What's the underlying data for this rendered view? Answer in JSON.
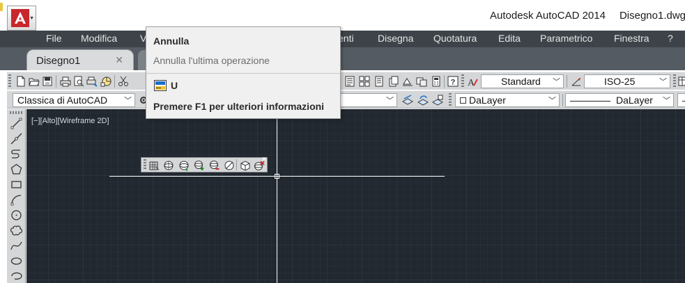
{
  "titlebar": {
    "app_name": "Autodesk AutoCAD 2014",
    "file_name": "Disegno1.dwg"
  },
  "menu": {
    "items": [
      "File",
      "Modifica",
      "V",
      "enti",
      "Disegna",
      "Quotatura",
      "Edita",
      "Parametrico",
      "Finestra",
      "?"
    ]
  },
  "tabs": {
    "active_label": "Disegno1",
    "close_glyph": "✕"
  },
  "toolbar1": {
    "text_style": "Standard",
    "dim_style": "ISO-25"
  },
  "toolbar2": {
    "workspace": "Classica di AutoCAD",
    "color": "DaLayer",
    "linetype": "DaLayer"
  },
  "viewport": {
    "label": "[−][Alto][Wireframe 2D]"
  },
  "tooltip": {
    "title": "Annulla",
    "description": "Annulla l'ultima operazione",
    "command": "U",
    "help": "Premere F1 per ulteriori informazioni"
  },
  "floating_toolbar": {
    "close_glyph": "×"
  },
  "colors": {
    "menubar_bg": "#3d4349",
    "canvas_bg": "#212830",
    "toolbar_bg": "#d4d6d8",
    "logo_red": "#c8272c"
  },
  "icons": {
    "toolbar1": [
      "new-icon",
      "open-icon",
      "save-icon",
      "print-icon",
      "print-preview-icon",
      "publish-icon",
      "3d-print-icon",
      "cut-icon",
      "properties-icon",
      "design-center-icon",
      "tool-palette-icon",
      "sheet-set-icon",
      "markup-icon",
      "quickcalc-icon",
      "help-icon",
      "text-style-icon",
      "dim-style-icon",
      "table-style-icon"
    ],
    "left_toolbar": [
      "line-icon",
      "construction-line-icon",
      "polyline-icon",
      "polygon-icon",
      "rectangle-icon",
      "arc-icon",
      "circle-icon",
      "revcloud-icon",
      "spline-icon",
      "ellipse-icon",
      "ellipse-arc-icon"
    ],
    "floating_toolbar": [
      "constrained-orbit-icon",
      "free-orbit-icon",
      "continuous-orbit-icon",
      "orbit-add-icon",
      "orbit-remove-icon",
      "cube-view-icon",
      "orbit-close-icon"
    ]
  }
}
